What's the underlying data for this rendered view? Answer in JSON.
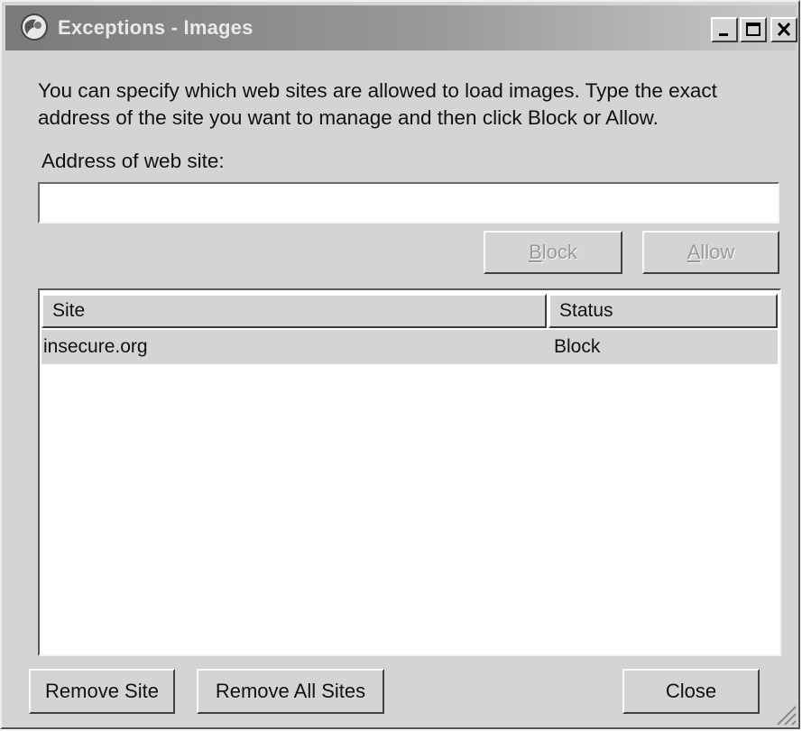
{
  "window": {
    "title": "Exceptions - Images",
    "app_icon": "firefox-globe-icon",
    "controls": {
      "minimize": "minimize-icon",
      "maximize": "maximize-icon",
      "close": "close-icon"
    }
  },
  "intro": {
    "line1": "You can specify which web sites are allowed to load images. Type the exact",
    "line2": "address of the site you want to manage and then click Block or Allow."
  },
  "address": {
    "label": "Address of web site:",
    "value": "",
    "placeholder": ""
  },
  "actions": {
    "block_label": "Block",
    "block_accesskey": "B",
    "allow_label": "Allow",
    "allow_accesskey": "A"
  },
  "table": {
    "columns": [
      "Site",
      "Status"
    ],
    "rows": [
      {
        "site": "insecure.org",
        "status": "Block"
      }
    ]
  },
  "footer": {
    "remove_site": "Remove Site",
    "remove_all_sites": "Remove All Sites",
    "close": "Close"
  },
  "colors": {
    "dialog_bg": "#d4d4d4",
    "titlebar_start": "#7a7a7a",
    "titlebar_end": "#c9c9c9",
    "selected_row": "#d4d4d4"
  }
}
